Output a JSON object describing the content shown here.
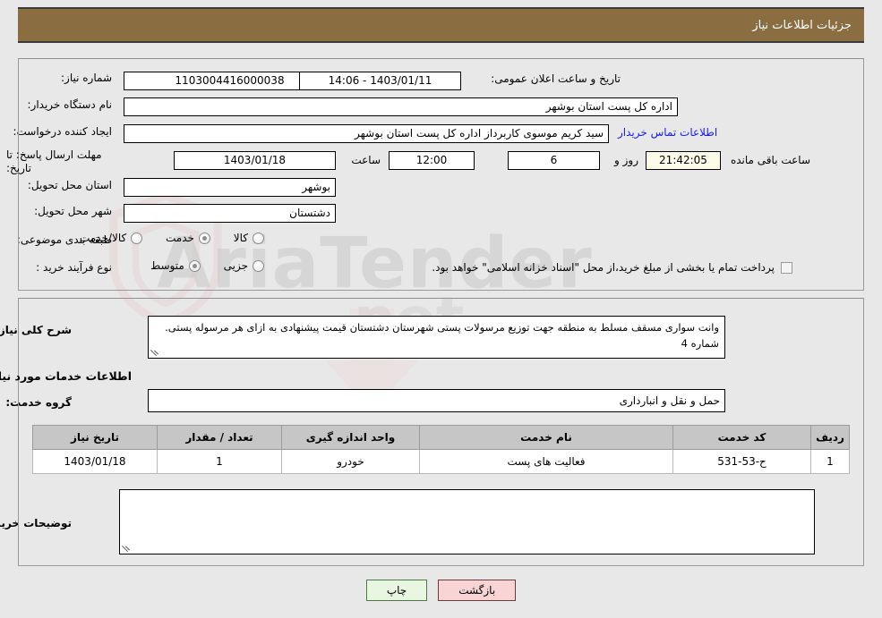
{
  "header": {
    "title": "جزئیات اطلاعات نیاز"
  },
  "top_panel": {
    "need_number_label": "شماره نیاز:",
    "need_number_value": "1103004416000038",
    "announce_label": "تاریخ و ساعت اعلان عمومی:",
    "announce_value": "1403/01/11 - 14:06",
    "buyer_org_label": "نام دستگاه خریدار:",
    "buyer_org_value": "اداره کل پست استان بوشهر",
    "creator_label": "ایجاد کننده درخواست:",
    "creator_value": "سید کریم موسوی کاربرداز اداره کل پست استان بوشهر",
    "contact_link": "اطلاعات تماس خریدار",
    "deadline_label": "مهلت ارسال پاسخ: تا تاریخ:",
    "deadline_date": "1403/01/18",
    "hour_label": "ساعت",
    "hour_value": "12:00",
    "days_value": "6",
    "days_label": "روز و",
    "countdown_value": "21:42:05",
    "countdown_label": "ساعت باقی مانده",
    "province_label": "استان محل تحویل:",
    "province_value": "بوشهر",
    "city_label": "شهر محل تحویل:",
    "city_value": "دشتستان",
    "category_label": "طبقه بندی موضوعی:",
    "category_options": [
      {
        "label": "کالا",
        "selected": false
      },
      {
        "label": "خدمت",
        "selected": true
      },
      {
        "label": "کالا/خدمت",
        "selected": false
      }
    ],
    "process_label": "نوع فرآیند خرید :",
    "process_options": [
      {
        "label": "جزیی",
        "selected": false
      },
      {
        "label": "متوسط",
        "selected": true
      }
    ],
    "treasury_checkbox_checked": false,
    "treasury_text": "پرداخت تمام یا بخشی از مبلغ خرید،از محل \"اسناد خزانه اسلامی\" خواهد بود."
  },
  "mid_panel": {
    "summary_label": "شرح کلی نیاز:",
    "summary_value": "وانت سواری مسقف مسلط به منطقه جهت توزیع مرسولات پستی شهرستان دشتستان قیمت پیشنهادی به ازای هر مرسوله پستی. شماره 4",
    "services_heading": "اطلاعات خدمات مورد نیاز",
    "service_group_label": "گروه خدمت:",
    "service_group_value": "حمل و نقل و انبارداری",
    "table": {
      "columns": [
        "ردیف",
        "کد خدمت",
        "نام خدمت",
        "واحد اندازه گیری",
        "تعداد / مقدار",
        "تاریخ نیاز"
      ],
      "rows": [
        {
          "row": "1",
          "service_code": "ح-53-531",
          "service_name": "فعالیت های پست",
          "unit": "خودرو",
          "quantity": "1",
          "need_date": "1403/01/18"
        }
      ]
    },
    "buyer_notes_label": "توضیحات خریدار:",
    "buyer_notes_value": ""
  },
  "footer": {
    "print_button": "چاپ",
    "back_button": "بازگشت"
  },
  "watermark": {
    "text": "AriaTender",
    "text2": ".net"
  },
  "colors": {
    "header_bg": "#8b6d42",
    "page_bg": "#e8e8e8",
    "link": "#1a1aee",
    "table_header_bg": "#c6c6c6",
    "back_button_bg": "#f8d4d4",
    "print_button_bg": "#e8f6e2",
    "countdown_bg": "#fbfbe8"
  }
}
